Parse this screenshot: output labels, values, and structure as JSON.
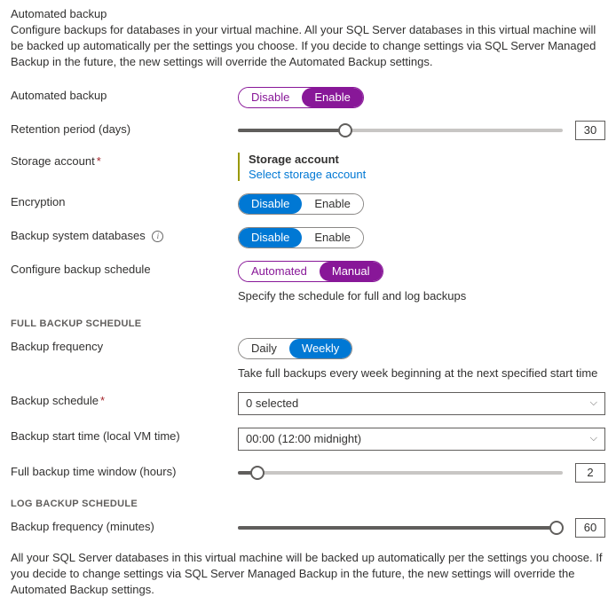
{
  "header": {
    "title": "Automated backup",
    "description": "Configure backups for databases in your virtual machine. All your SQL Server databases in this virtual machine will be backed up automatically per the settings you choose. If you decide to change settings via SQL Server Managed Backup in the future, the new settings will override the Automated Backup settings."
  },
  "labels": {
    "automated_backup": "Automated backup",
    "retention": "Retention period (days)",
    "storage_account": "Storage account",
    "encryption": "Encryption",
    "backup_system_db": "Backup system databases",
    "config_schedule": "Configure backup schedule",
    "full_section": "FULL BACKUP SCHEDULE",
    "backup_frequency": "Backup frequency",
    "backup_schedule": "Backup schedule",
    "backup_start_time": "Backup start time (local VM time)",
    "full_window": "Full backup time window (hours)",
    "log_section": "LOG BACKUP SCHEDULE",
    "log_frequency": "Backup frequency (minutes)"
  },
  "toggles": {
    "disable": "Disable",
    "enable": "Enable",
    "automated": "Automated",
    "manual": "Manual",
    "daily": "Daily",
    "weekly": "Weekly"
  },
  "storage": {
    "heading": "Storage account",
    "link": "Select storage account"
  },
  "hints": {
    "schedule": "Specify the schedule for full and log backups",
    "frequency": "Take full backups every week beginning at the next specified start time"
  },
  "values": {
    "retention": "30",
    "backup_schedule": "0 selected",
    "start_time": "00:00 (12:00 midnight)",
    "full_window": "2",
    "log_frequency": "60"
  },
  "footer": "All your SQL Server databases in this virtual machine will be backed up automatically per the settings you choose. If you decide to change settings via SQL Server Managed Backup in the future, the new settings will override the Automated Backup settings."
}
